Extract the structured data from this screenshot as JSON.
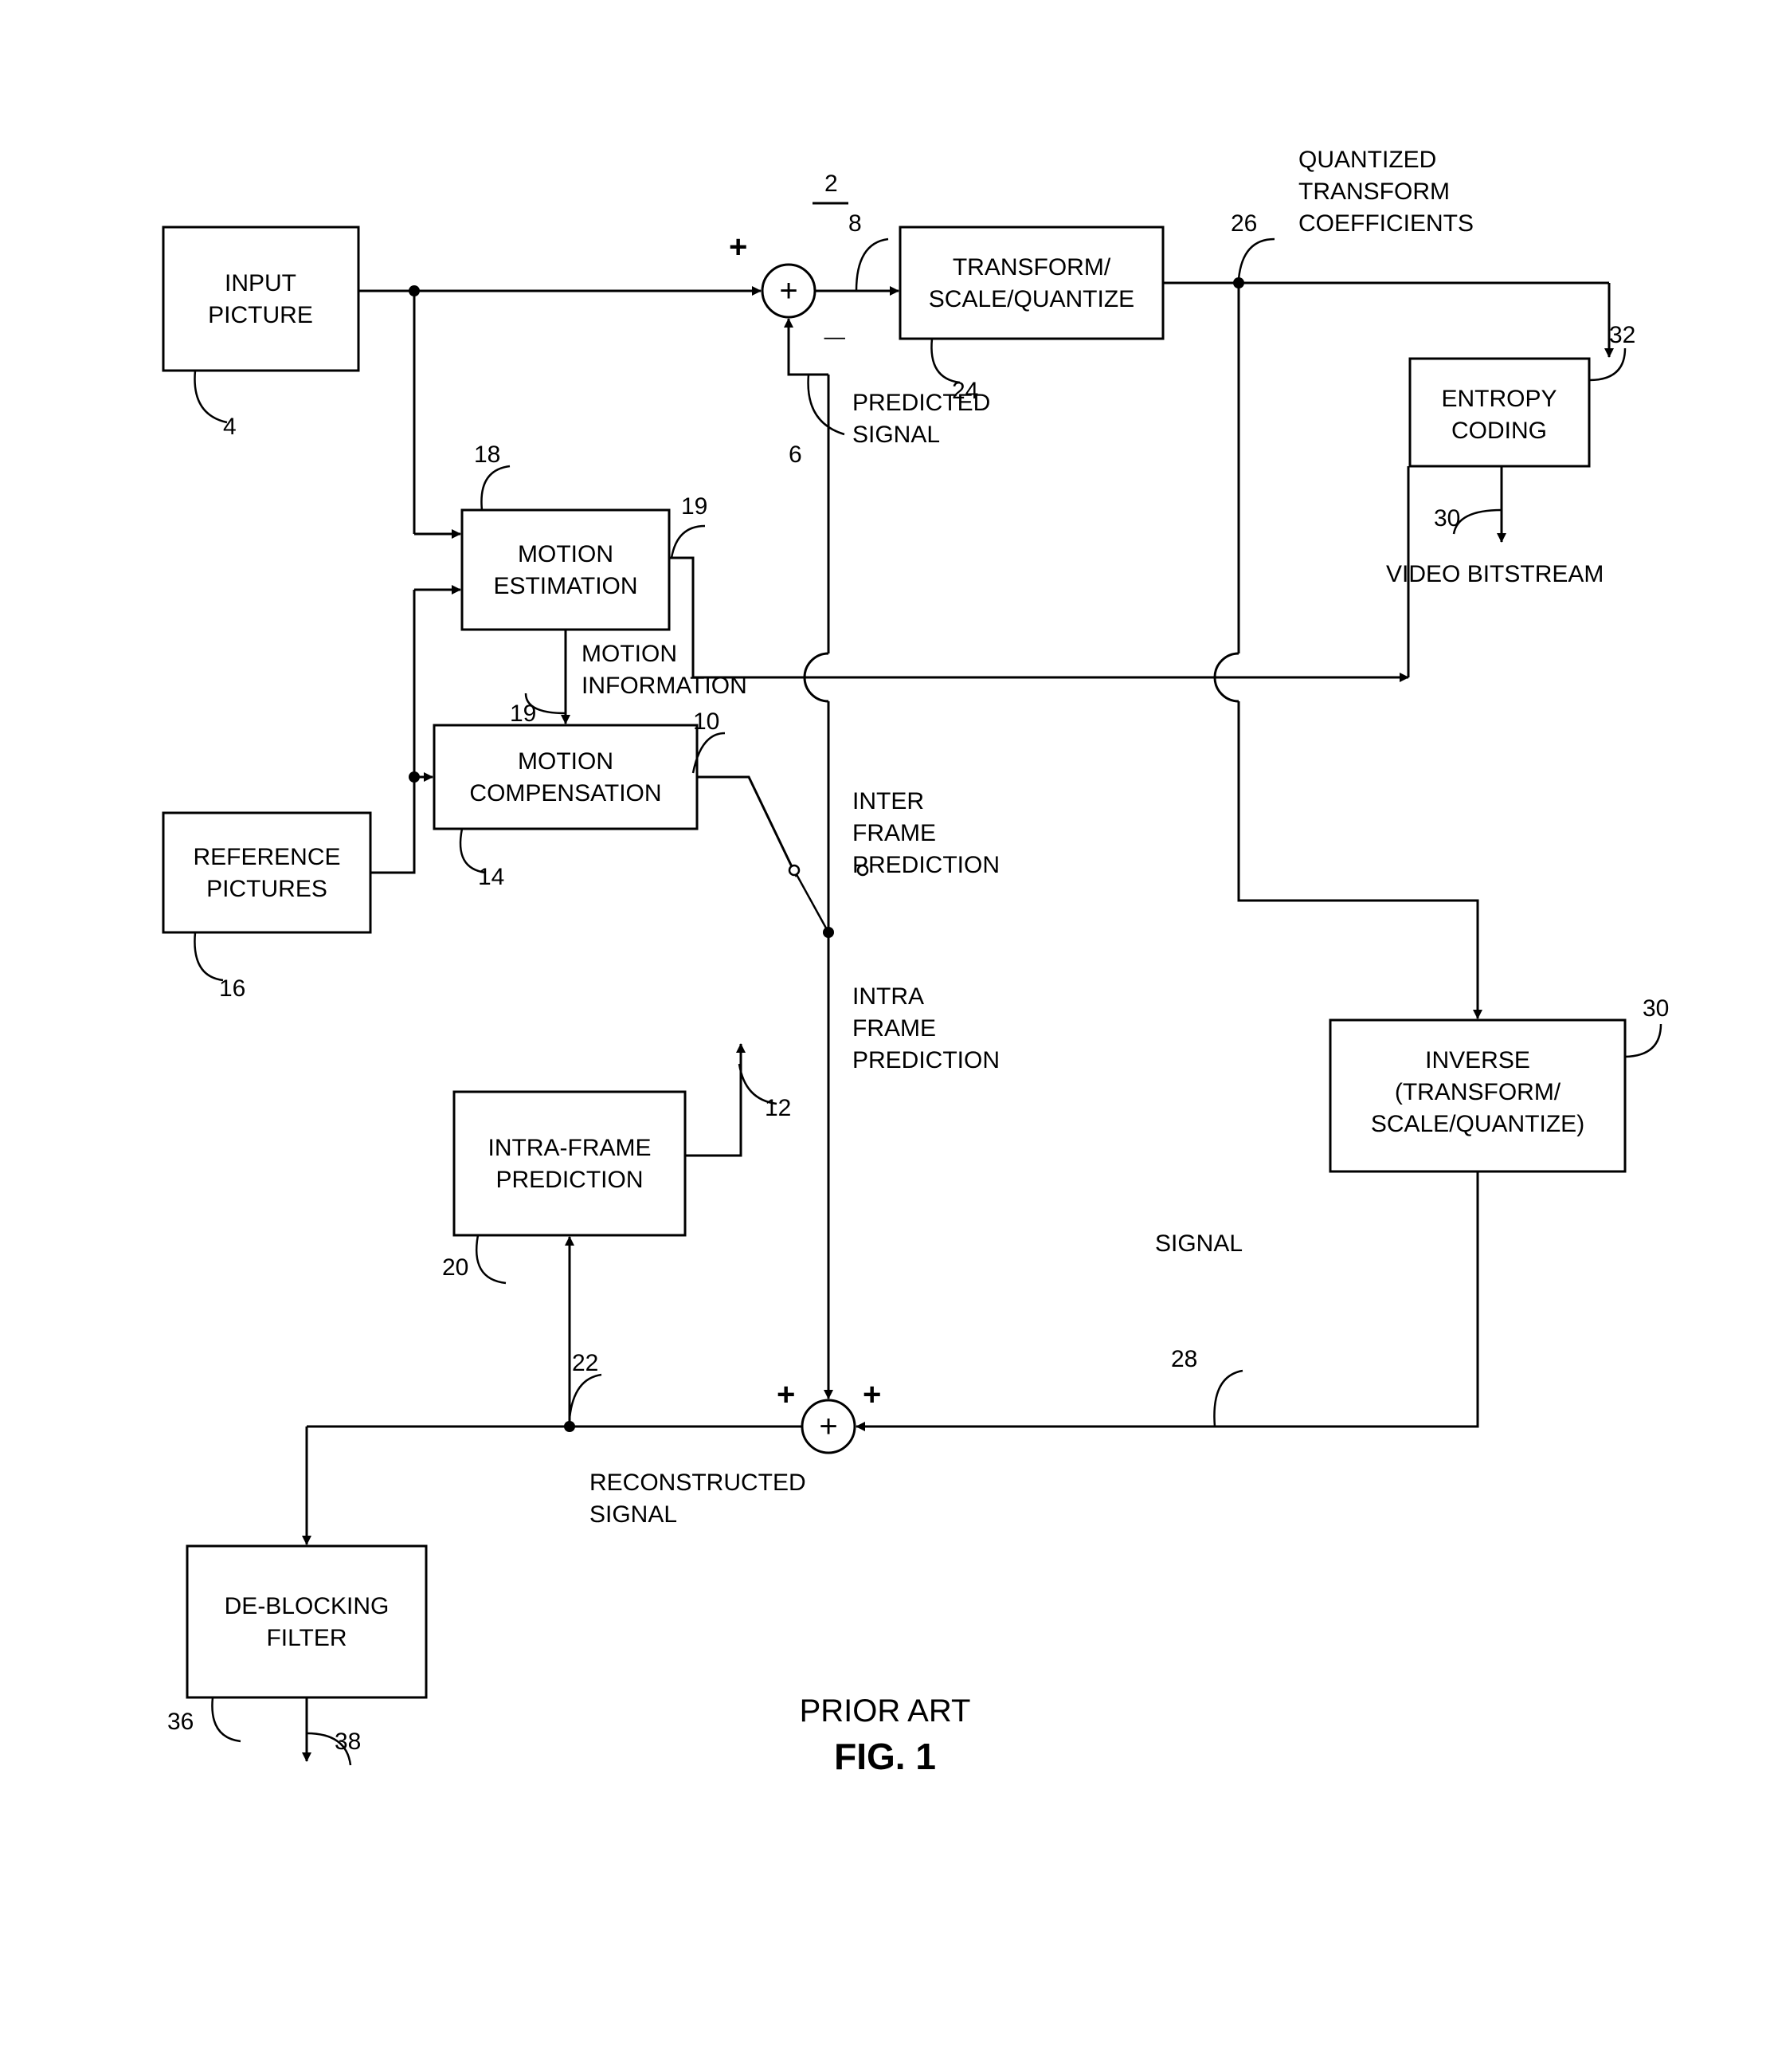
{
  "blocks": {
    "input_picture_l1": "INPUT",
    "input_picture_l2": "PICTURE",
    "motion_estimation_l1": "MOTION",
    "motion_estimation_l2": "ESTIMATION",
    "motion_compensation_l1": "MOTION",
    "motion_compensation_l2": "COMPENSATION",
    "reference_pictures_l1": "REFERENCE",
    "reference_pictures_l2": "PICTURES",
    "transform_l1": "TRANSFORM/",
    "transform_l2": "SCALE/QUANTIZE",
    "entropy_l1": "ENTROPY",
    "entropy_l2": "CODING",
    "inverse_l1": "INVERSE",
    "inverse_l2": "(TRANSFORM/",
    "inverse_l3": "SCALE/QUANTIZE)",
    "intra_frame_l1": "INTRA-FRAME",
    "intra_frame_l2": "PREDICTION",
    "deblock_l1": "DE-BLOCKING",
    "deblock_l2": "FILTER"
  },
  "labels": {
    "predicted_l1": "PREDICTED",
    "predicted_l2": "SIGNAL",
    "inter_l1": "INTER",
    "inter_l2": "FRAME",
    "inter_l3": "PREDICTION",
    "intra_l1": "INTRA",
    "intra_l2": "FRAME",
    "intra_l3": "PREDICTION",
    "motion_info_l1": "MOTION",
    "motion_info_l2": "INFORMATION",
    "quantized_l1": "QUANTIZED",
    "quantized_l2": "TRANSFORM",
    "quantized_l3": "COEFFICIENTS",
    "video_bitstream": "VIDEO BITSTREAM",
    "signal": "SIGNAL",
    "reconstructed_l1": "RECONSTRUCTED",
    "reconstructed_l2": "SIGNAL"
  },
  "refs": {
    "r2": "2",
    "r4": "4",
    "r6": "6",
    "r8": "8",
    "r10": "10",
    "r12": "12",
    "r14": "14",
    "r16": "16",
    "r18": "18",
    "r19a": "19",
    "r19b": "19",
    "r20": "20",
    "r22": "22",
    "r24": "24",
    "r26": "26",
    "r28": "28",
    "r30a": "30",
    "r30b": "30",
    "r32": "32",
    "r36": "36",
    "r38": "38"
  },
  "signs": {
    "plus": "+",
    "minus": "_"
  },
  "caption": {
    "prior_art": "PRIOR ART",
    "fig": "FIG. 1"
  }
}
